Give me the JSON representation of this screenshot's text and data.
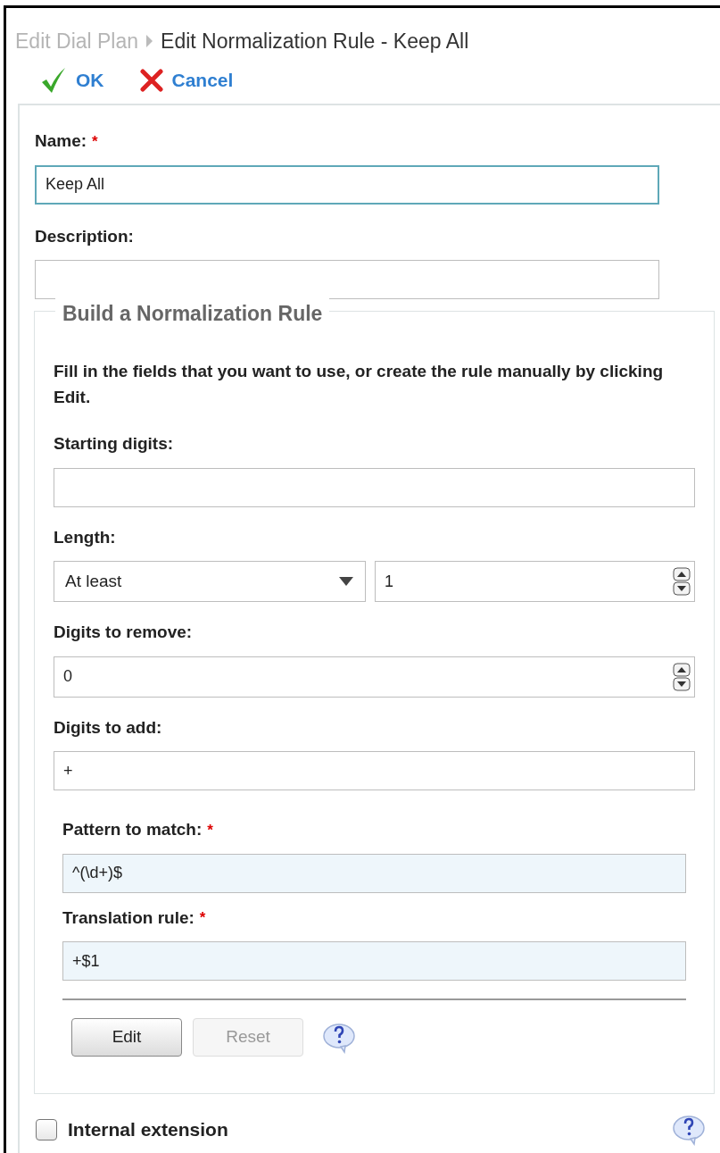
{
  "breadcrumb": {
    "parent": "Edit Dial Plan",
    "current": "Edit Normalization Rule - Keep All"
  },
  "actions": [
    {
      "kind": "ok",
      "label": "OK"
    },
    {
      "kind": "cancel",
      "label": "Cancel"
    }
  ],
  "fields": [
    {
      "kind": "text",
      "label": "Name:",
      "required_mark": "*",
      "value": "Keep All",
      "focused": true
    },
    {
      "kind": "text",
      "label": "Description:",
      "focused": false
    }
  ],
  "rule_builder": {
    "legend": "Build a Normalization Rule",
    "instructions": "Fill in the fields that you want to use, or create the rule manually by clicking Edit.",
    "fields": [
      {
        "kind": "text",
        "label": "Starting digits:",
        "highlighted": false
      },
      {
        "kind": "length",
        "label": "Length:",
        "option": "At least",
        "value": "1"
      },
      {
        "kind": "spinner",
        "label": "Digits to remove:",
        "highlighted": false,
        "value": "0"
      },
      {
        "kind": "text",
        "label": "Digits to add:",
        "highlighted": false,
        "value": "+"
      }
    ],
    "rule_fields": [
      {
        "kind": "text",
        "label": "Pattern to match:",
        "required_mark": "*",
        "highlighted": true,
        "value": "^(\\d+)$"
      },
      {
        "kind": "text",
        "label": "Translation rule:",
        "required_mark": "*",
        "highlighted": true,
        "value": "+$1"
      }
    ],
    "buttons": [
      {
        "label": "Edit",
        "disabled": false
      },
      {
        "label": "Reset",
        "disabled": true
      }
    ]
  },
  "internal_extension": {
    "label": "Internal extension",
    "checked": false
  }
}
